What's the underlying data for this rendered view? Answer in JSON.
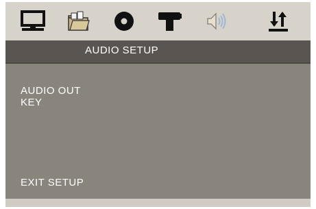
{
  "header": {
    "tabs": [
      {
        "icon": "monitor-icon"
      },
      {
        "icon": "folder-icon"
      },
      {
        "icon": "disc-icon"
      },
      {
        "icon": "speaker-stand-icon"
      },
      {
        "icon": "audio-icon"
      },
      {
        "icon": "sort-arrows-icon"
      }
    ]
  },
  "title": "AUDIO SETUP",
  "menu": {
    "items": [
      "AUDIO OUT",
      "KEY"
    ],
    "exit": "EXIT SETUP"
  },
  "colors": {
    "panel": "#8a857c",
    "icon_bar": "#d7d3cb",
    "title_bar": "#5a5550",
    "text": "#ffffff"
  }
}
